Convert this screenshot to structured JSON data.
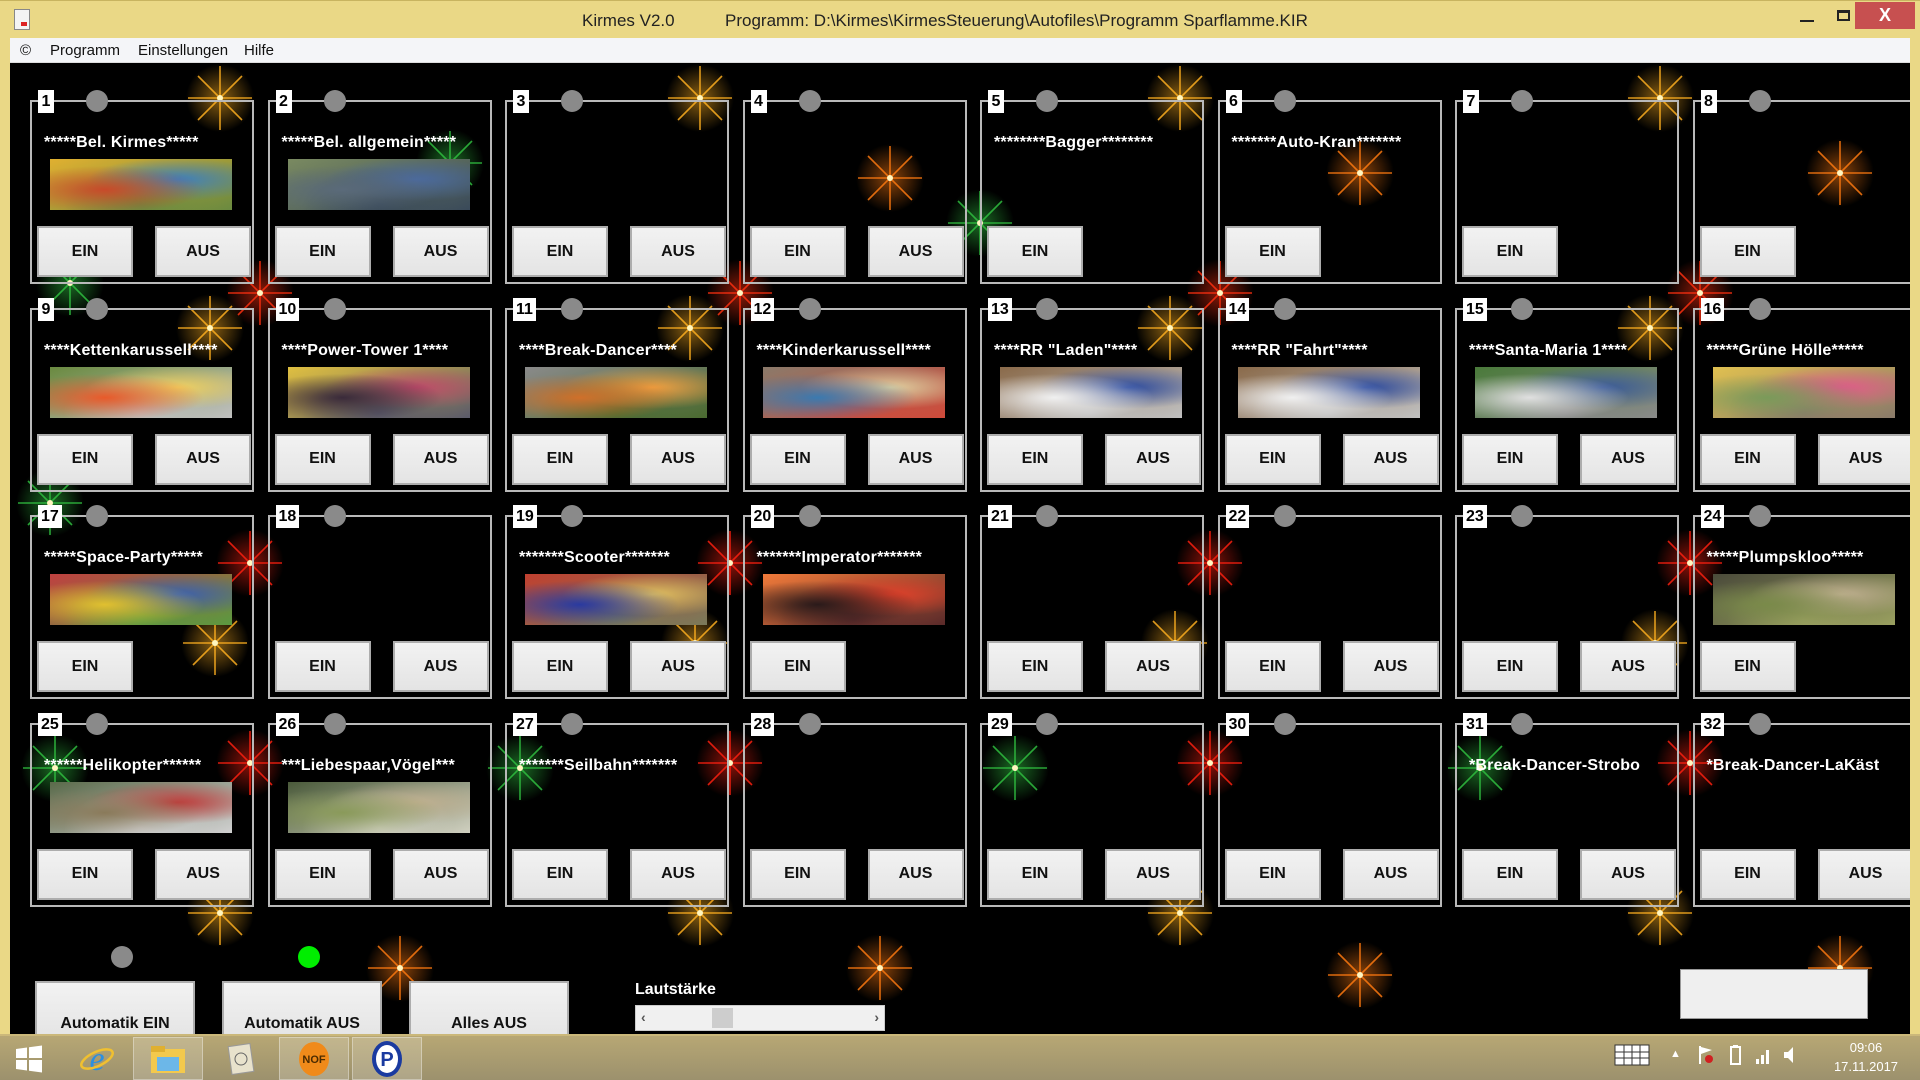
{
  "window": {
    "app_title": "Kirmes V2.0",
    "program_path": "Programm: D:\\Kirmes\\KirmesSteuerung\\Autofiles\\Programm Sparflamme.KIR",
    "minimize_label": "",
    "maximize_label": "",
    "close_label": "X"
  },
  "menu": {
    "items": [
      {
        "label": "©"
      },
      {
        "label": "Programm"
      },
      {
        "label": "Einstellungen"
      },
      {
        "label": "Hilfe"
      }
    ]
  },
  "colors": {
    "led_off": "#8a8a8a",
    "led_on": "#00ee00",
    "titlebar": "#ead886",
    "close": "#c75050",
    "background": "#000000"
  },
  "panels": [
    {
      "number": "1",
      "title": "*****Bel.  Kirmes*****",
      "image": "kirmes",
      "led": "off",
      "ein": "EIN",
      "aus": "AUS"
    },
    {
      "number": "2",
      "title": "*****Bel. allgemein*****",
      "image": "allgemein",
      "led": "off",
      "ein": "EIN",
      "aus": "AUS"
    },
    {
      "number": "3",
      "title": "",
      "image": null,
      "led": "off",
      "ein": "EIN",
      "aus": "AUS"
    },
    {
      "number": "4",
      "title": "",
      "image": null,
      "led": "off",
      "ein": "EIN",
      "aus": "AUS"
    },
    {
      "number": "5",
      "title": "********Bagger********",
      "image": null,
      "led": "off",
      "ein": "EIN",
      "aus": null
    },
    {
      "number": "6",
      "title": "*******Auto-Kran*******",
      "image": null,
      "led": "off",
      "ein": "EIN",
      "aus": null
    },
    {
      "number": "7",
      "title": "",
      "image": null,
      "led": "off",
      "ein": "EIN",
      "aus": null
    },
    {
      "number": "8",
      "title": "",
      "image": null,
      "led": "off",
      "ein": "EIN",
      "aus": null
    },
    {
      "number": "9",
      "title": "****Kettenkarussell****",
      "image": "kettenkarussell",
      "led": "off",
      "ein": "EIN",
      "aus": "AUS"
    },
    {
      "number": "10",
      "title": "****Power-Tower 1****",
      "image": "powertower",
      "led": "off",
      "ein": "EIN",
      "aus": "AUS"
    },
    {
      "number": "11",
      "title": "****Break-Dancer****",
      "image": "breakdancer",
      "led": "off",
      "ein": "EIN",
      "aus": "AUS"
    },
    {
      "number": "12",
      "title": "****Kinderkarussell****",
      "image": "kinderkarussell",
      "led": "off",
      "ein": "EIN",
      "aus": "AUS"
    },
    {
      "number": "13",
      "title": "****RR  \"Laden\"****",
      "image": "riesenrad",
      "led": "off",
      "ein": "EIN",
      "aus": "AUS"
    },
    {
      "number": "14",
      "title": "****RR  \"Fahrt\"****",
      "image": "riesenrad",
      "led": "off",
      "ein": "EIN",
      "aus": "AUS"
    },
    {
      "number": "15",
      "title": "****Santa-Maria 1****",
      "image": "santamaria",
      "led": "off",
      "ein": "EIN",
      "aus": "AUS"
    },
    {
      "number": "16",
      "title": "*****Grüne Hölle*****",
      "image": "gruenehoelle",
      "led": "off",
      "ein": "EIN",
      "aus": "AUS"
    },
    {
      "number": "17",
      "title": "*****Space-Party*****",
      "image": "spaceparty",
      "led": "off",
      "ein": "EIN",
      "aus": null
    },
    {
      "number": "18",
      "title": "",
      "image": null,
      "led": "off",
      "ein": "EIN",
      "aus": "AUS"
    },
    {
      "number": "19",
      "title": "*******Scooter*******",
      "image": "scooter",
      "led": "off",
      "ein": "EIN",
      "aus": "AUS"
    },
    {
      "number": "20",
      "title": "*******Imperator*******",
      "image": "imperator",
      "led": "off",
      "ein": "EIN",
      "aus": null
    },
    {
      "number": "21",
      "title": "",
      "image": null,
      "led": "off",
      "ein": "EIN",
      "aus": "AUS"
    },
    {
      "number": "22",
      "title": "",
      "image": null,
      "led": "off",
      "ein": "EIN",
      "aus": "AUS"
    },
    {
      "number": "23",
      "title": "",
      "image": null,
      "led": "off",
      "ein": "EIN",
      "aus": "AUS"
    },
    {
      "number": "24",
      "title": "*****Plumpskloo*****",
      "image": "plumpskloo",
      "led": "off",
      "ein": "EIN",
      "aus": null
    },
    {
      "number": "25",
      "title": "******Helikopter******",
      "image": "helikopter",
      "led": "off",
      "ein": "EIN",
      "aus": "AUS"
    },
    {
      "number": "26",
      "title": "***Liebespaar,Vögel***",
      "image": "liebespaar",
      "led": "off",
      "ein": "EIN",
      "aus": "AUS"
    },
    {
      "number": "27",
      "title": "*******Seilbahn*******",
      "image": null,
      "led": "off",
      "ein": "EIN",
      "aus": "AUS"
    },
    {
      "number": "28",
      "title": "",
      "image": null,
      "led": "off",
      "ein": "EIN",
      "aus": "AUS"
    },
    {
      "number": "29",
      "title": "",
      "image": null,
      "led": "off",
      "ein": "EIN",
      "aus": "AUS"
    },
    {
      "number": "30",
      "title": "",
      "image": null,
      "led": "off",
      "ein": "EIN",
      "aus": "AUS"
    },
    {
      "number": "31",
      "title": "*Break-Dancer-Strobo",
      "image": null,
      "led": "off",
      "ein": "EIN",
      "aus": "AUS"
    },
    {
      "number": "32",
      "title": "*Break-Dancer-LaKäst",
      "image": null,
      "led": "off",
      "ein": "EIN",
      "aus": "AUS"
    }
  ],
  "image_palettes": {
    "kirmes": [
      "#c84a2a",
      "#3b7fc0",
      "#e0b030",
      "#6a8a40"
    ],
    "allgemein": [
      "#5a6a7a",
      "#4a6aa0",
      "#7a8a60",
      "#3a4a5a"
    ],
    "kettenkarussell": [
      "#e85a2a",
      "#f0d060",
      "#6a8a40",
      "#c0c0c0"
    ],
    "powertower": [
      "#3a2a3a",
      "#c04a6a",
      "#e0c040",
      "#5a5a6a"
    ],
    "breakdancer": [
      "#d0702a",
      "#f0a040",
      "#8a8a8a",
      "#4a6a30"
    ],
    "kinderkarussell": [
      "#3a7ab0",
      "#e0d0a0",
      "#8a7a6a",
      "#d04a3a"
    ],
    "riesenrad": [
      "#f0f0f0",
      "#2a4aa0",
      "#8a6a4a",
      "#c0c0c0"
    ],
    "santamaria": [
      "#e0e0e0",
      "#3a5a9a",
      "#4a7a3a",
      "#8a8a8a"
    ],
    "gruenehoelle": [
      "#7a9a5a",
      "#e05a8a",
      "#e0c050",
      "#8a7a6a"
    ],
    "spaceparty": [
      "#e0c030",
      "#3a60b0",
      "#c04040",
      "#5a9a40"
    ],
    "scooter": [
      "#2a3aa0",
      "#e0c060",
      "#c04030",
      "#7a7a5a"
    ],
    "imperator": [
      "#2a1a1a",
      "#e0402a",
      "#f07a3a",
      "#5a2a2a"
    ],
    "plumpskloo": [
      "#7a8a4a",
      "#c0b090",
      "#4a4a3a",
      "#9aa060"
    ],
    "helikopter": [
      "#8a7a5a",
      "#c03a3a",
      "#5a6a4a",
      "#d0d0d0"
    ],
    "liebespaar": [
      "#8a9a5a",
      "#c0b090",
      "#4a5a3a",
      "#d0d0c0"
    ]
  },
  "automatik": {
    "ein_led": "off",
    "aus_led": "on",
    "ein_label": "Automatik EIN",
    "aus_label": "Automatik AUS",
    "alles_aus_label": "Alles AUS"
  },
  "volume": {
    "label": "Lautstärke",
    "left_arrow": "‹",
    "right_arrow": "›",
    "value_fraction": 0.29
  },
  "status_box": {
    "text": ""
  },
  "taskbar": {
    "apps": [
      {
        "name": "start-button"
      },
      {
        "name": "internet-explorer"
      },
      {
        "name": "file-explorer"
      },
      {
        "name": "kirmes-app"
      },
      {
        "name": "nof-app"
      },
      {
        "name": "p-app"
      }
    ],
    "time": "09:06",
    "date": "17.11.2017"
  }
}
